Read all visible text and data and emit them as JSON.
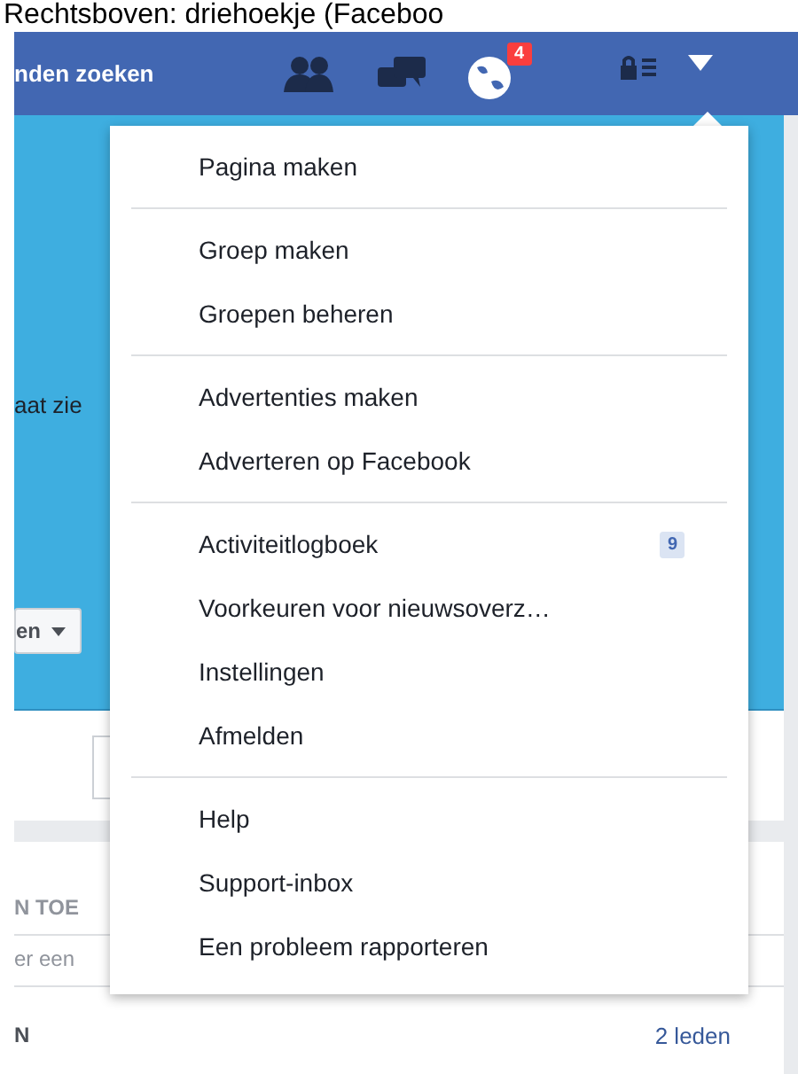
{
  "caption": "Rechtsboven: driehoekje (Faceboo",
  "header": {
    "search_text": "nden zoeken",
    "notifications_badge": "4"
  },
  "page": {
    "cover_text": "aat zie",
    "cover_button": "en",
    "section_heading": "N TOE",
    "input_placeholder": "er een",
    "row_label": "N",
    "row_count": "2 leden"
  },
  "menu": {
    "groups": [
      {
        "items": [
          {
            "label": "Pagina maken"
          }
        ]
      },
      {
        "items": [
          {
            "label": "Groep maken"
          },
          {
            "label": "Groepen beheren"
          }
        ]
      },
      {
        "items": [
          {
            "label": "Advertenties maken"
          },
          {
            "label": "Adverteren op Facebook"
          }
        ]
      },
      {
        "items": [
          {
            "label": "Activiteitlogboek",
            "badge": "9"
          },
          {
            "label": "Voorkeuren voor nieuwsoverz…"
          },
          {
            "label": "Instellingen"
          },
          {
            "label": "Afmelden"
          }
        ]
      },
      {
        "items": [
          {
            "label": "Help"
          },
          {
            "label": "Support-inbox"
          },
          {
            "label": "Een probleem rapporteren"
          }
        ]
      }
    ]
  }
}
